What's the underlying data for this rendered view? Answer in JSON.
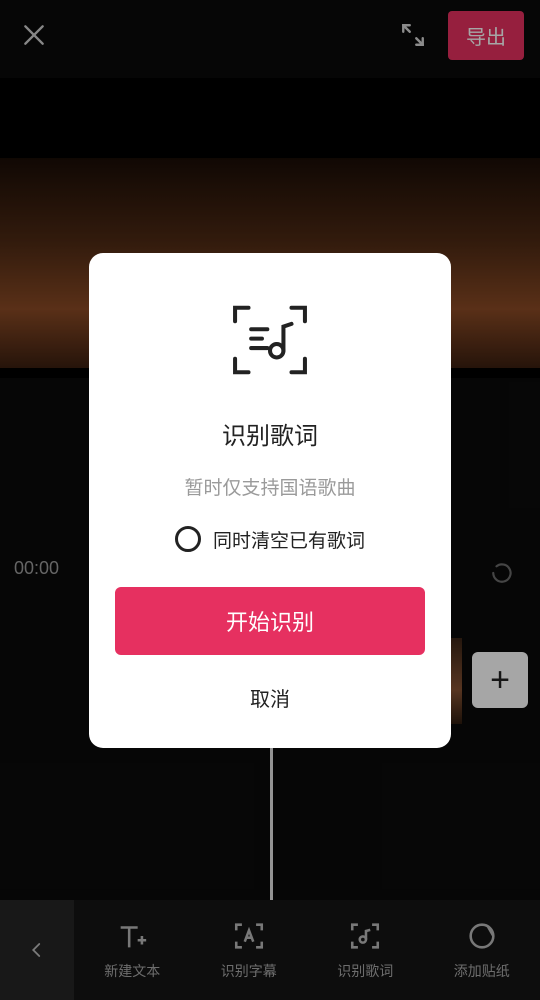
{
  "topbar": {
    "export_label": "导出"
  },
  "timeline": {
    "time": "00:00"
  },
  "modal": {
    "title": "识别歌词",
    "subtitle": "暂时仅支持国语歌曲",
    "checkbox_label": "同时清空已有歌词",
    "primary_label": "开始识别",
    "cancel_label": "取消"
  },
  "tools": {
    "new_text": "新建文本",
    "rec_subtitle": "识别字幕",
    "rec_lyrics": "识别歌词",
    "add_sticker": "添加贴纸"
  },
  "icons": {
    "close": "close-icon",
    "expand": "expand-icon",
    "add": "+"
  }
}
